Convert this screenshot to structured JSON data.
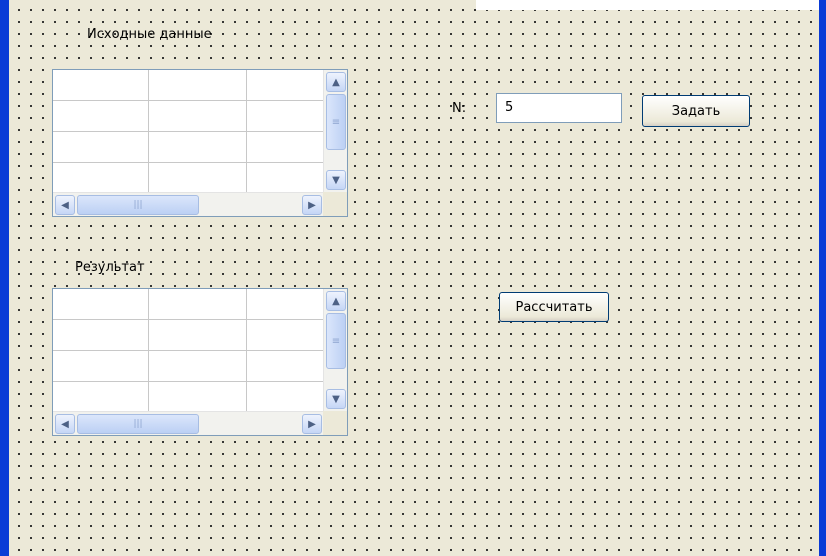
{
  "form": {
    "source_label": "Исходные данные",
    "result_label": "Результат",
    "n_label": "N:",
    "n_value": "5",
    "set_button": "Задать",
    "calc_button": "Рассчитать"
  },
  "scroll": {
    "up_icon": "▲",
    "down_icon": "▼",
    "left_icon": "◀",
    "right_icon": "▶",
    "v_grip": "≡",
    "h_grip": "|||"
  }
}
